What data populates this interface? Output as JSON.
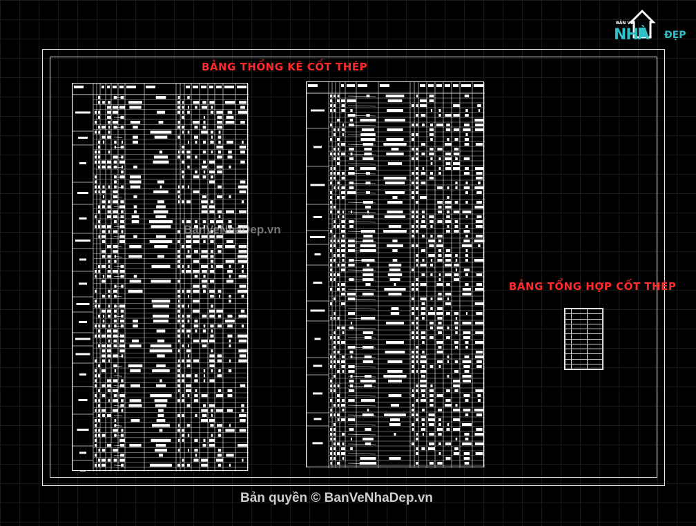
{
  "drawing": {
    "title_left": "BẢNG THỐNG KÊ CỐT THÉP",
    "title_right": "BẢNG TỔNG HỢP CỐT THÉP",
    "watermark": "BanVeNhaDep.vn",
    "copyright": "Bản quyền © BanVeNhaDep.vn"
  },
  "logo": {
    "top_text": "BẢN VẼ",
    "main_text": "NHÀ",
    "sub_text": "ĐẸP",
    "icon": "house-icon"
  },
  "colors": {
    "background": "#000000",
    "lines": "#e8e8e8",
    "title_red": "#ff2a2a",
    "logo_teal": "#2fc0c8"
  }
}
